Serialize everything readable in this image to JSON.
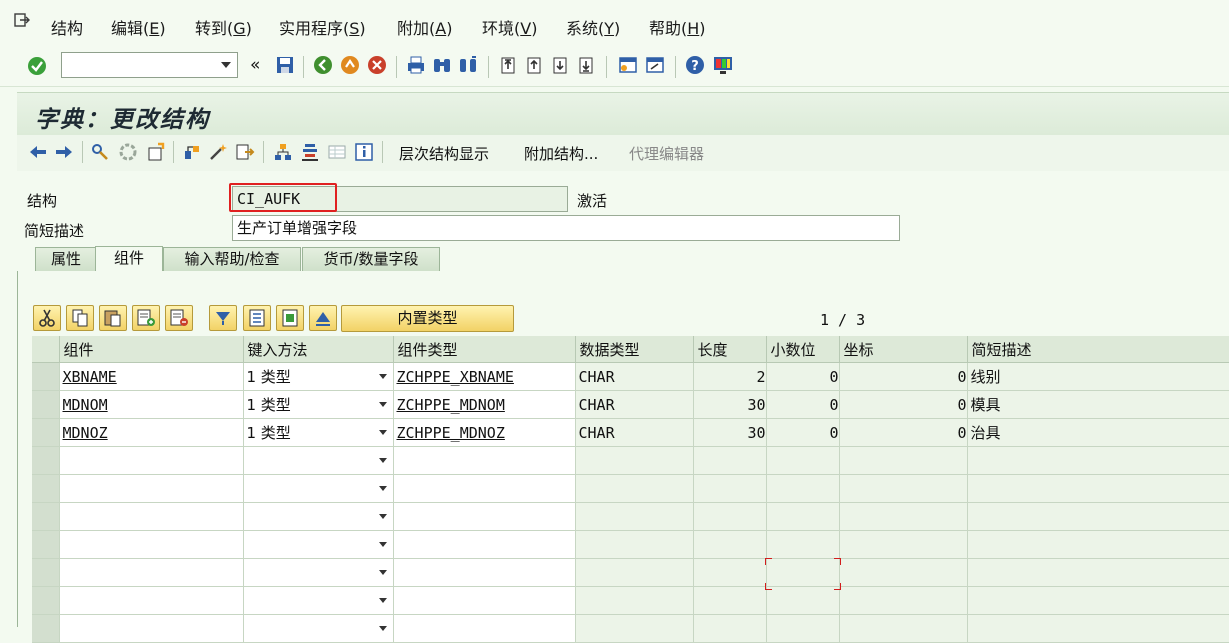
{
  "menu": {
    "items": [
      {
        "label": "结构",
        "key": ""
      },
      {
        "label": "编辑(",
        "key": "E",
        "tail": ")"
      },
      {
        "label": "转到(",
        "key": "G",
        "tail": ")"
      },
      {
        "label": "实用程序(",
        "key": "S",
        "tail": ")"
      },
      {
        "label": "附加(",
        "key": "A",
        "tail": ")"
      },
      {
        "label": "环境(",
        "key": "V",
        "tail": ")"
      },
      {
        "label": "系统(",
        "key": "Y",
        "tail": ")"
      },
      {
        "label": "帮助(",
        "key": "H",
        "tail": ")"
      }
    ]
  },
  "toolbar": {
    "back_symbol": "«",
    "command_value": ""
  },
  "title": "字典：更改结构",
  "app_toolbar": {
    "hierarchy_label": "层次结构显示",
    "append_label": "附加结构...",
    "proxy_label": "代理编辑器"
  },
  "header": {
    "structure_label": "结构",
    "structure_value": "CI_AUFK",
    "status": "激活",
    "desc_label": "简短描述",
    "desc_value": "生产订单增强字段"
  },
  "tabs": [
    {
      "label": "属性",
      "active": false
    },
    {
      "label": "组件",
      "active": true
    },
    {
      "label": "输入帮助/检查",
      "active": false
    },
    {
      "label": "货币/数量字段",
      "active": false
    }
  ],
  "components": {
    "builtin_type_label": "内置类型",
    "pager": "1 / 3",
    "columns": [
      "组件",
      "键入方法",
      "组件类型",
      "数据类型",
      "长度",
      "小数位",
      "坐标",
      "简短描述"
    ],
    "rows": [
      {
        "component": "XBNAME",
        "method": "1 类型",
        "comp_type": "ZCHPPE_XBNAME",
        "data_type": "CHAR",
        "length": "2",
        "decimals": "0",
        "coord": "0",
        "desc": "线别"
      },
      {
        "component": "MDNOM",
        "method": "1 类型",
        "comp_type": "ZCHPPE_MDNOM",
        "data_type": "CHAR",
        "length": "30",
        "decimals": "0",
        "coord": "0",
        "desc": "模具"
      },
      {
        "component": "MDNOZ",
        "method": "1 类型",
        "comp_type": "ZCHPPE_MDNOZ",
        "data_type": "CHAR",
        "length": "30",
        "decimals": "0",
        "coord": "0",
        "desc": "治具"
      }
    ],
    "empty_rows": 7
  }
}
